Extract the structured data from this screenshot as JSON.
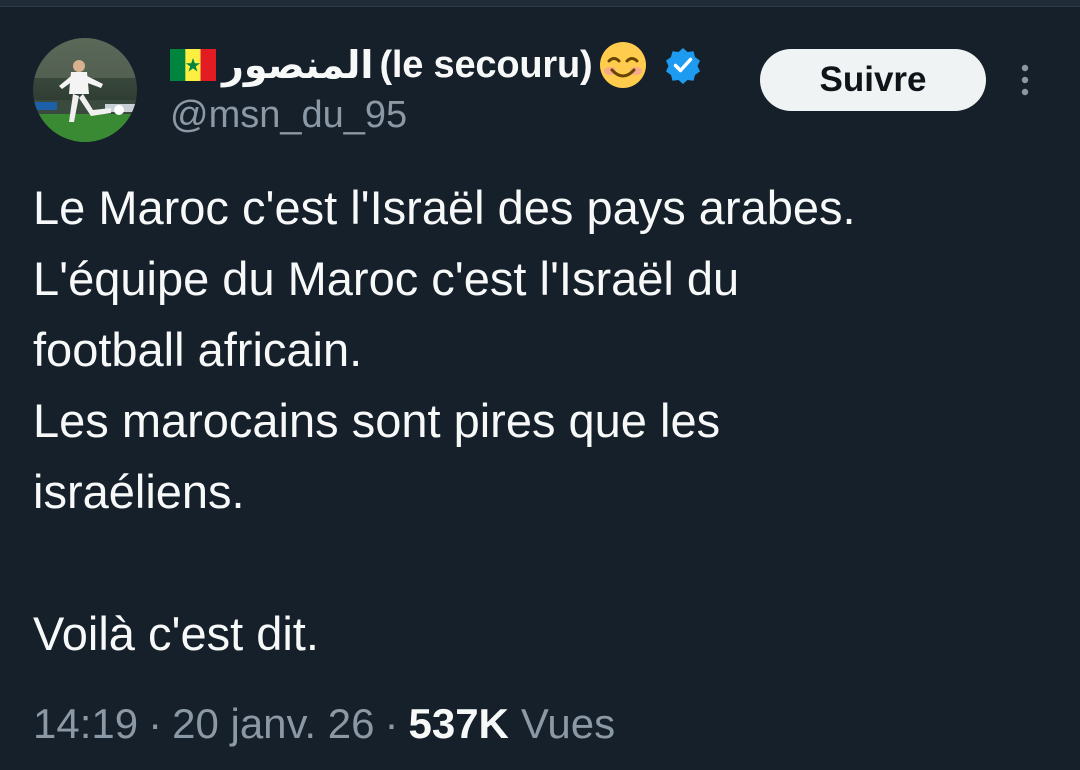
{
  "author": {
    "display_name_arabic": "المنصور",
    "display_name_latin": "(le secouru)",
    "handle": "@msn_du_95",
    "flag_icon": "senegal-flag-icon",
    "emoji_icon": "smiling-face-icon",
    "verified_icon": "verified-badge-icon",
    "verified_color": "#1d9bf0"
  },
  "actions": {
    "follow_label": "Suivre",
    "more_icon": "more-vertical-icon"
  },
  "tweet": {
    "lines": [
      "Le Maroc c'est l'Israël des pays arabes.",
      "L'équipe du Maroc c'est l'Israël du",
      "football africain.",
      "Les marocains sont pires que les",
      "israéliens.",
      "",
      "Voilà c'est dit."
    ]
  },
  "meta": {
    "time": "14:19",
    "separator": "·",
    "date": "20 janv. 26",
    "views_count": "537K",
    "views_label": "Vues"
  },
  "colors": {
    "background": "#16202a",
    "text_primary": "#f7f9f9",
    "text_secondary": "#8b98a5",
    "button_bg": "#eff3f4"
  }
}
